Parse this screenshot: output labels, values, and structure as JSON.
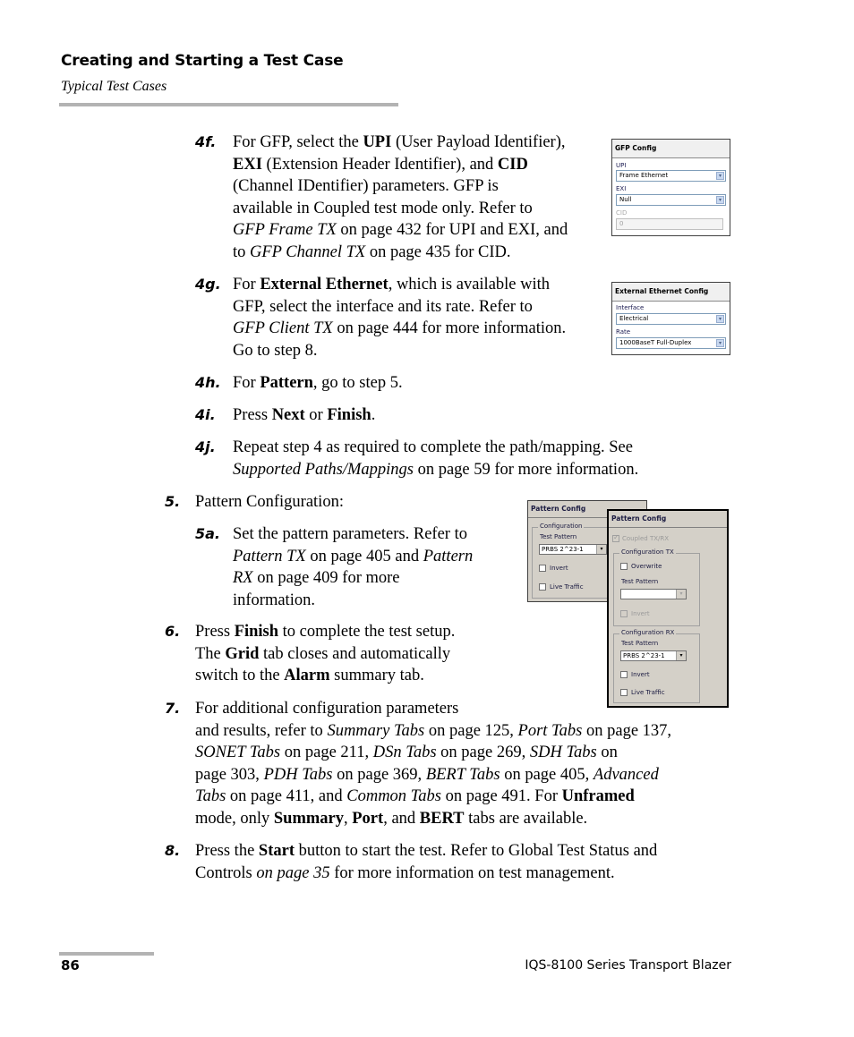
{
  "header": {
    "title": "Creating and Starting a Test Case",
    "subtitle": "Typical Test Cases"
  },
  "steps": {
    "s4f": {
      "num": "4f.",
      "p1": "For GFP, select the ",
      "b1": "UPI",
      "p2": " (User Payload Identifier),",
      "b2": "EXI",
      "p3": " (Extension Header Identifier), and ",
      "b3": "CID",
      "p4": "(Channel IDentifier) parameters. GFP is",
      "p5": "available in Coupled test mode only. Refer to",
      "i1": "GFP Frame TX",
      "p6": " on page 432 for UPI and EXI, and",
      "p7": "to ",
      "i2": "GFP Channel TX",
      "p8": " on page 435 for CID."
    },
    "s4g": {
      "num": "4g.",
      "p1": "For ",
      "b1": "External Ethernet",
      "p2": ", which is available with",
      "p3": "GFP, select the interface and its rate. Refer to",
      "i1": "GFP Client TX",
      "p4": " on page 444 for more information.",
      "p5": "Go to step 8."
    },
    "s4h": {
      "num": "4h.",
      "p1": "For ",
      "b1": "Pattern",
      "p2": ", go to step 5."
    },
    "s4i": {
      "num": "4i.",
      "p1": "Press ",
      "b1": "Next",
      "p2": " or ",
      "b2": "Finish",
      "p3": "."
    },
    "s4j": {
      "num": "4j.",
      "p1": "Repeat step 4 as required to complete the path/mapping. See",
      "i1": "Supported Paths/Mappings",
      "p2": " on page 59 for more information."
    },
    "s5": {
      "num": "5.",
      "p1": "Pattern Configuration:"
    },
    "s5a": {
      "num": "5a.",
      "p1": "Set the pattern parameters. Refer to",
      "i1": "Pattern TX",
      "p2": " on page 405 and ",
      "i2": "Pattern",
      "i3": "RX",
      "p3": " on page 409 for more",
      "p4": "information."
    },
    "s6": {
      "num": "6.",
      "p1": "Press ",
      "b1": "Finish",
      "p2": " to complete the test setup.",
      "p3": "The ",
      "b2": "Grid",
      "p4": " tab closes and automatically",
      "p5": "switch to the ",
      "b3": "Alarm",
      "p6": " summary tab."
    },
    "s7": {
      "num": "7.",
      "p1": "For additional configuration parameters",
      "p2": "and results, refer to ",
      "i1": "Summary Tabs",
      "p3": " on page 125, ",
      "i2": "Port Tabs",
      "p4": " on page 137,",
      "i3": "SONET Tabs",
      "p5": " on page 211, ",
      "i4": "DSn Tabs",
      "p6": " on page 269, ",
      "i5": "SDH Tabs",
      "p7": " on",
      "p8": "page 303, ",
      "i6": "PDH Tabs",
      "p9": " on page 369, ",
      "i7": "BERT Tabs",
      "p10": " on page 405, ",
      "i8": "Advanced",
      "i9": "Tabs",
      "p11": " on page 411, and ",
      "i10": "Common Tabs",
      "p12": " on page 491. For ",
      "b1": "Unframed",
      "p13": "mode, only ",
      "b2": "Summary",
      "p14": ", ",
      "b3": "Port",
      "p15": ", and ",
      "b4": "BERT",
      "p16": " tabs are available."
    },
    "s8": {
      "num": "8.",
      "p1": "Press the ",
      "b1": "Start",
      "p2": " button to start the test. Refer to Global Test Status and",
      "p3": "Controls ",
      "i1": "on page 35",
      "p4": " for more information on test management."
    }
  },
  "gfp_panel": {
    "title": "GFP Config",
    "upi_label": "UPI",
    "upi_value": "Frame Ethernet",
    "exi_label": "EXI",
    "exi_value": "Null",
    "cid_label": "CID",
    "cid_value": "0",
    "dropdown_glyph": "▾"
  },
  "ext_eth_panel": {
    "title": "External Ethernet Config",
    "interface_label": "Interface",
    "interface_value": "Electrical",
    "rate_label": "Rate",
    "rate_value": "1000BaseT Full-Duplex",
    "dropdown_glyph": "▾"
  },
  "pattern_panel_back": {
    "title": "Pattern Config",
    "group_label": "Configuration",
    "test_pattern_label": "Test Pattern",
    "test_pattern_value": "PRBS 2^23-1",
    "invert_label": "Invert",
    "invert_checked": false,
    "live_traffic_label": "Live Traffic",
    "live_traffic_checked": false,
    "dropdown_glyph": "▾"
  },
  "pattern_panel_front": {
    "title": "Pattern Config",
    "coupled_label": "Coupled TX/RX",
    "coupled_checked": true,
    "tx_group_label": "Configuration TX",
    "overwrite_label": "Overwrite",
    "overwrite_checked": false,
    "tx_test_pattern_label": "Test Pattern",
    "tx_test_pattern_value": "",
    "tx_invert_label": "Invert",
    "rx_group_label": "Configuration RX",
    "rx_test_pattern_label": "Test Pattern",
    "rx_test_pattern_value": "PRBS 2^23-1",
    "rx_invert_label": "Invert",
    "rx_live_traffic_label": "Live Traffic",
    "dropdown_glyph": "▾"
  },
  "footer": {
    "page_number": "86",
    "book_title": "IQS-8100 Series Transport Blazer"
  }
}
